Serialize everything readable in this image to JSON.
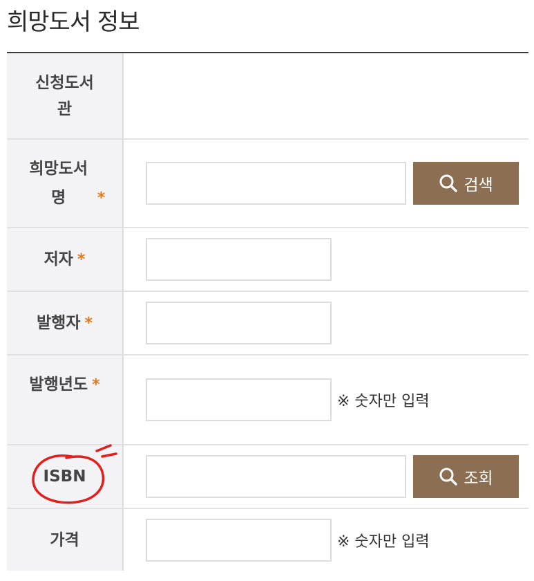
{
  "page": {
    "title": "희망도서 정보"
  },
  "rows": {
    "library": {
      "label": "신청도서관"
    },
    "book_title": {
      "label": "희망도서명",
      "required": "*",
      "value": "",
      "button": "검색"
    },
    "author": {
      "label": "저자",
      "required": "*",
      "value": ""
    },
    "publisher": {
      "label": "발행자",
      "required": "*",
      "value": ""
    },
    "year": {
      "label": "발행년도",
      "required": "*",
      "value": "",
      "note": "※ 숫자만 입력"
    },
    "isbn": {
      "label": "ISBN",
      "value": "",
      "button": "조회"
    },
    "price": {
      "label": "가격",
      "value": "",
      "note": "※ 숫자만 입력"
    }
  },
  "icons": {
    "search": "search-icon",
    "annotation": "red-circle-annotation"
  },
  "colors": {
    "button_bg": "#8c6e52",
    "required": "#e07a1f",
    "annotation": "#e0201c",
    "label_bg": "#f3f3f5"
  }
}
